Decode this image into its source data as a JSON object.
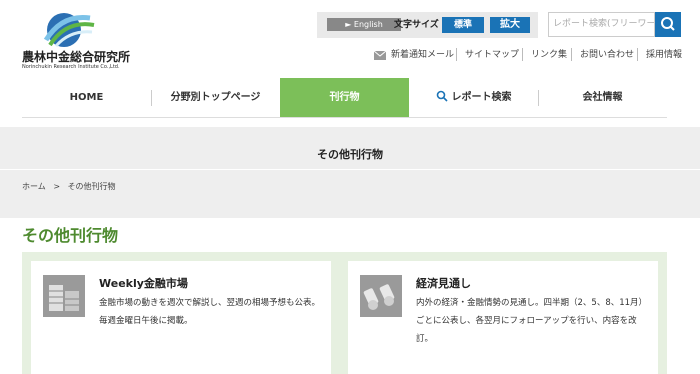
{
  "logo": {
    "name": "農林中金総合研究所",
    "sub": "Norinchukin Research Institute Co.,Ltd."
  },
  "toolbar": {
    "english": "English",
    "font_size_label": "文字サイズ",
    "font_standard": "標準",
    "font_large": "拡大"
  },
  "search": {
    "placeholder": "レポート検索(フリーワード)"
  },
  "util_links": [
    "新着通知メール",
    "サイトマップ",
    "リンク集",
    "お問い合わせ",
    "採用情報"
  ],
  "nav": [
    {
      "label": "HOME"
    },
    {
      "label": "分野別トップページ"
    },
    {
      "label": "刊行物"
    },
    {
      "label": "レポート検索"
    },
    {
      "label": "会社情報"
    }
  ],
  "page": {
    "hero_title": "その他刊行物",
    "breadcrumb_home": "ホーム",
    "breadcrumb_sep": ">",
    "breadcrumb_current": "その他刊行物",
    "section_title": "その他刊行物"
  },
  "cards": [
    {
      "title": "Weekly金融市場",
      "desc": "金融市場の動きを週次で解説し、翌週の相場予想も公表。毎週金曜日午後に掲載。",
      "icon": "building-icon"
    },
    {
      "title": "経済見通し",
      "desc": "内外の経済・金融情勢の見通し。四半期（2、5、8、11月）ごとに公表し、各翌月にフォローアップを行い、内容を改訂。",
      "icon": "binoculars-icon"
    }
  ],
  "colors": {
    "accent_blue": "#1a73b6",
    "accent_green": "#7cbf59",
    "title_green": "#4e8a2f"
  }
}
